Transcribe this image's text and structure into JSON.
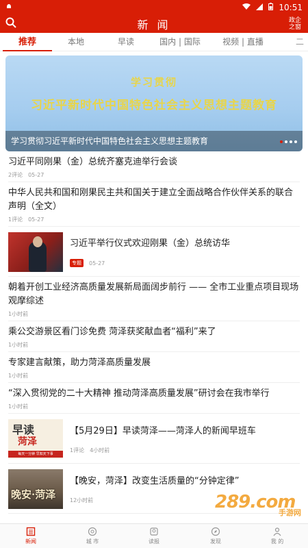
{
  "status_bar": {
    "time": "10:51"
  },
  "header": {
    "title": "新 闻",
    "gov_link_line1": "政企",
    "gov_link_line2": "之窗"
  },
  "tabs": [
    {
      "label": "推荐",
      "active": true
    },
    {
      "label": "本地"
    },
    {
      "label": "早读"
    },
    {
      "label": "国内 | 国际"
    },
    {
      "label": "视频 | 直播"
    }
  ],
  "tabs_more": "二",
  "banner": {
    "line1": "学习贯彻",
    "line2": "习近平新时代中国特色社会主义思想主题教育",
    "caption": "学习贯彻习近平新时代中国特色社会主义思想主题教育"
  },
  "news": [
    {
      "title": "习近平同刚果（金）总统齐塞克迪举行会谈",
      "comments": "2评论",
      "time": "05-27"
    },
    {
      "title": "中华人民共和国和刚果民主共和国关于建立全面战略合作伙伴关系的联合声明（全文）",
      "comments": "1评论",
      "time": "05-27"
    },
    {
      "title": "习近平举行仪式欢迎刚果（金）总统访华",
      "tag": "专题",
      "time": "05-27"
    },
    {
      "title": "朝着开创工业经济高质量发展新局面阔步前行 —— 全市工业重点项目现场观摩综述",
      "time": "1小时前"
    },
    {
      "title": "乘公交游景区看门诊免费 菏泽获奖献血者“福利”来了",
      "time": "1小时前"
    },
    {
      "title": "专家建言献策，助力菏泽高质量发展",
      "time": "1小时前"
    },
    {
      "title": "“深入贯彻党的二十大精神 推动菏泽高质量发展”研讨会在我市举行",
      "time": "1小时前"
    },
    {
      "title": "【5月29日】早读菏泽——菏泽人的新闻早班车",
      "comments": "1评论",
      "time": "4小时前"
    },
    {
      "title": "【晚安，菏泽】改变生活质量的“分钟定律”",
      "time": "12小时前"
    }
  ],
  "thumbs": {
    "zaodu_big": "早读",
    "zaodu_city": "菏泽",
    "zaodu_bar": "每天一分钟 早知天下事",
    "wanan": "晚安·菏泽"
  },
  "watermark": {
    "num": "289.com",
    "sub": "手游网"
  },
  "bottom_nav": [
    {
      "label": "新闻",
      "active": true
    },
    {
      "label": "城 市"
    },
    {
      "label": "读报"
    },
    {
      "label": "发现"
    },
    {
      "label": "我 的"
    }
  ],
  "colors": {
    "brand_red": "#d81e06"
  }
}
